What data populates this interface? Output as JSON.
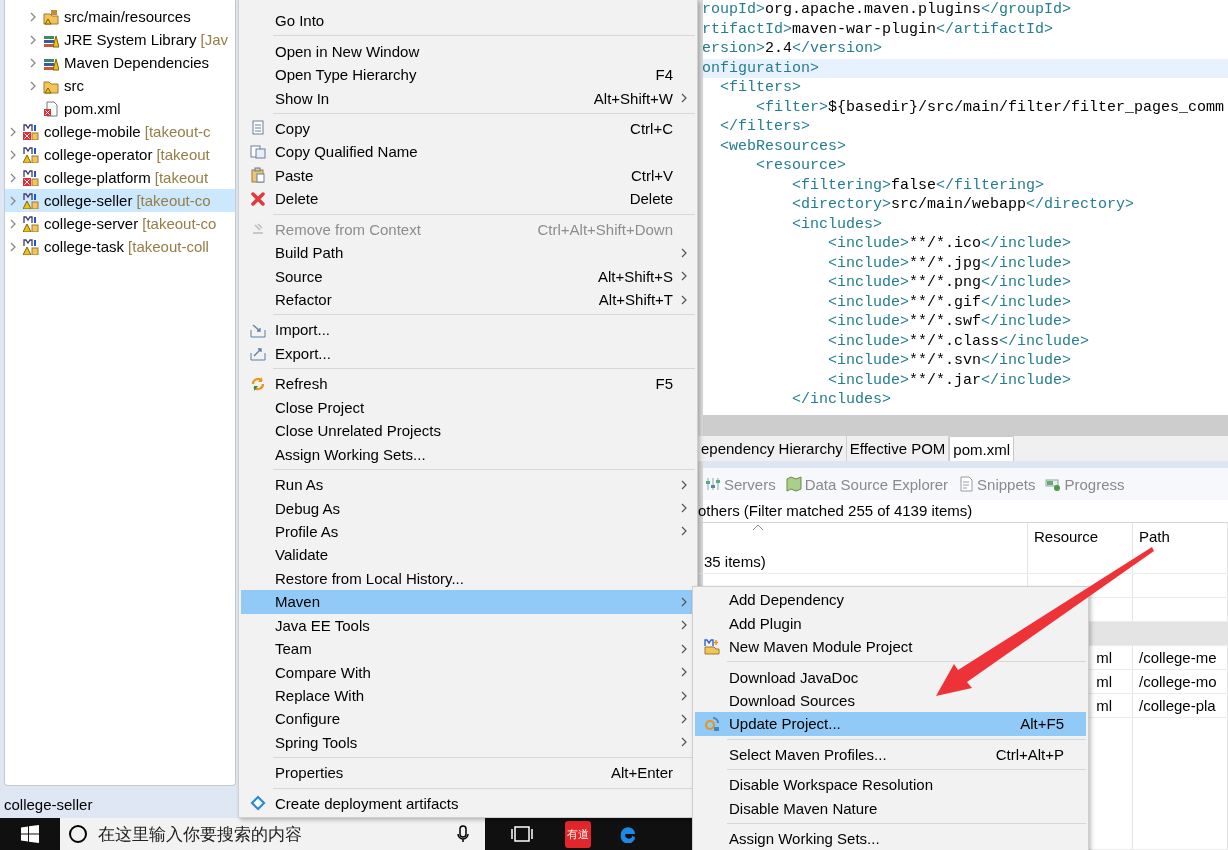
{
  "tree": {
    "items": [
      {
        "children": [
          {
            "label": "src/main/resources",
            "kind": "source",
            "expandable": true,
            "selected": false
          },
          {
            "label": "JRE System Library",
            "decoration": "[Jav",
            "kind": "library",
            "expandable": true,
            "selected": false
          },
          {
            "label": "Maven Dependencies",
            "kind": "library",
            "expandable": true,
            "selected": false
          },
          {
            "label": "src",
            "kind": "folder",
            "expandable": true,
            "selected": false
          },
          {
            "label": "pom.xml",
            "kind": "xml",
            "expandable": false,
            "selected": false
          }
        ]
      },
      {
        "label": "college-mobile",
        "decoration": "[takeout-c",
        "error": true,
        "expandable": true,
        "selected": false
      },
      {
        "label": "college-operator",
        "decoration": "[takeout",
        "error": false,
        "expandable": true,
        "selected": false
      },
      {
        "label": "college-platform",
        "decoration": "[takeout",
        "error": true,
        "expandable": true,
        "selected": false
      },
      {
        "label": "college-seller",
        "decoration": "[takeout-co",
        "error": false,
        "expandable": true,
        "selected": true
      },
      {
        "label": "college-server",
        "decoration": "[takeout-co",
        "error": false,
        "expandable": true,
        "selected": false
      },
      {
        "label": "college-task",
        "decoration": "[takeout-coll",
        "error": false,
        "expandable": true,
        "selected": false
      }
    ]
  },
  "status_bar": {
    "text": "college-seller"
  },
  "taskbar": {
    "search": {
      "placeholder": "在这里输入你要搜索的内容"
    },
    "apps": [
      {
        "kind": "taskview"
      },
      {
        "kind": "youdao",
        "label": "有道"
      },
      {
        "kind": "edge"
      }
    ]
  },
  "editor": {
    "lines": [
      {
        "current": false,
        "segments": [
          {
            "kind": "tag",
            "text": "roupId>"
          },
          {
            "kind": "text",
            "text": "org.apache.maven.plugins"
          },
          {
            "kind": "tag",
            "text": "</groupId>"
          }
        ]
      },
      {
        "current": false,
        "segments": [
          {
            "kind": "tag",
            "text": "rtifactId>"
          },
          {
            "kind": "text",
            "text": "maven-war-plugin"
          },
          {
            "kind": "tag",
            "text": "</artifactId>"
          }
        ]
      },
      {
        "current": false,
        "segments": [
          {
            "kind": "tag",
            "text": "ersion>"
          },
          {
            "kind": "text",
            "text": "2.4"
          },
          {
            "kind": "tag",
            "text": "</version>"
          }
        ]
      },
      {
        "current": true,
        "segments": [
          {
            "kind": "tag",
            "text": "onfiguration>"
          }
        ]
      },
      {
        "current": false,
        "segments": [
          {
            "kind": "tag",
            "text": "  <filters>"
          }
        ]
      },
      {
        "current": false,
        "segments": [
          {
            "kind": "tag",
            "text": "      <filter>"
          },
          {
            "kind": "text",
            "text": "${basedir}/src/main/filter/filter_pages_comm"
          }
        ]
      },
      {
        "current": false,
        "segments": [
          {
            "kind": "tag",
            "text": "  </filters>"
          }
        ]
      },
      {
        "current": false,
        "segments": [
          {
            "kind": "tag",
            "text": "  <webResources>"
          }
        ]
      },
      {
        "current": false,
        "segments": [
          {
            "kind": "tag",
            "text": "      <resource>"
          }
        ]
      },
      {
        "current": false,
        "segments": [
          {
            "kind": "tag",
            "text": "          <filtering>"
          },
          {
            "kind": "text",
            "text": "false"
          },
          {
            "kind": "tag",
            "text": "</filtering>"
          }
        ]
      },
      {
        "current": false,
        "segments": [
          {
            "kind": "tag",
            "text": "          <directory>"
          },
          {
            "kind": "text",
            "text": "src/main/webapp"
          },
          {
            "kind": "tag",
            "text": "</directory>"
          }
        ]
      },
      {
        "current": false,
        "segments": [
          {
            "kind": "tag",
            "text": "          <includes>"
          }
        ]
      },
      {
        "current": false,
        "segments": [
          {
            "kind": "tag",
            "text": "              <include>"
          },
          {
            "kind": "text",
            "text": "**/*.ico"
          },
          {
            "kind": "tag",
            "text": "</include>"
          }
        ]
      },
      {
        "current": false,
        "segments": [
          {
            "kind": "tag",
            "text": "              <include>"
          },
          {
            "kind": "text",
            "text": "**/*.jpg"
          },
          {
            "kind": "tag",
            "text": "</include>"
          }
        ]
      },
      {
        "current": false,
        "segments": [
          {
            "kind": "tag",
            "text": "              <include>"
          },
          {
            "kind": "text",
            "text": "**/*.png"
          },
          {
            "kind": "tag",
            "text": "</include>"
          }
        ]
      },
      {
        "current": false,
        "segments": [
          {
            "kind": "tag",
            "text": "              <include>"
          },
          {
            "kind": "text",
            "text": "**/*.gif"
          },
          {
            "kind": "tag",
            "text": "</include>"
          }
        ]
      },
      {
        "current": false,
        "segments": [
          {
            "kind": "tag",
            "text": "              <include>"
          },
          {
            "kind": "text",
            "text": "**/*.swf"
          },
          {
            "kind": "tag",
            "text": "</include>"
          }
        ]
      },
      {
        "current": false,
        "segments": [
          {
            "kind": "tag",
            "text": "              <include>"
          },
          {
            "kind": "text",
            "text": "**/*.class"
          },
          {
            "kind": "tag",
            "text": "</include>"
          }
        ]
      },
      {
        "current": false,
        "segments": [
          {
            "kind": "tag",
            "text": "              <include>"
          },
          {
            "kind": "text",
            "text": "**/*.svn"
          },
          {
            "kind": "tag",
            "text": "</include>"
          }
        ]
      },
      {
        "current": false,
        "segments": [
          {
            "kind": "tag",
            "text": "              <include>"
          },
          {
            "kind": "text",
            "text": "**/*.jar"
          },
          {
            "kind": "tag",
            "text": "</include>"
          }
        ]
      },
      {
        "current": false,
        "segments": [
          {
            "kind": "tag",
            "text": "          </includes>"
          }
        ]
      }
    ]
  },
  "editor_tabs": [
    {
      "label": "ependency Hierarchy",
      "selected": false
    },
    {
      "label": "Effective POM",
      "selected": false
    },
    {
      "label": "pom.xml",
      "selected": true
    }
  ],
  "views": [
    {
      "label": "Servers",
      "kind": "servers"
    },
    {
      "label": "Data Source Explorer",
      "kind": "datasource"
    },
    {
      "label": "Snippets",
      "kind": "snippets"
    },
    {
      "label": "Progress",
      "kind": "progress"
    }
  ],
  "problems": {
    "summary": "others (Filter matched 255 of 4139 items)",
    "columns": [
      {
        "sorted": true
      },
      {
        "label": "Resource",
        "sorted": false
      },
      {
        "label": "Path",
        "sorted": false
      }
    ],
    "rows": [
      {
        "kind": "category",
        "name": "35 items)"
      },
      {
        "kind": "blank"
      },
      {
        "kind": "blank"
      },
      {
        "kind": "shaded"
      },
      {
        "kind": "file",
        "resource": "ml",
        "path": "/college-me"
      },
      {
        "kind": "file",
        "resource": "ml",
        "path": "/college-mo"
      },
      {
        "kind": "file",
        "resource": "ml",
        "path": "/college-pla"
      }
    ]
  },
  "context_menu": {
    "groups": [
      [
        {
          "label": "Go Into",
          "kind": "plain",
          "submenu": false,
          "selected": false,
          "disabled": false
        }
      ],
      [
        {
          "label": "Open in New Window",
          "kind": "plain",
          "submenu": false,
          "selected": false,
          "disabled": false
        },
        {
          "label": "Open Type Hierarchy",
          "shortcut": "F4",
          "kind": "plain",
          "submenu": false,
          "selected": false,
          "disabled": false
        },
        {
          "label": "Show In",
          "shortcut": "Alt+Shift+W",
          "kind": "plain",
          "submenu": true,
          "selected": false,
          "disabled": false
        }
      ],
      [
        {
          "label": "Copy",
          "shortcut": "Ctrl+C",
          "kind": "copy",
          "submenu": false,
          "selected": false,
          "disabled": false
        },
        {
          "label": "Copy Qualified Name",
          "kind": "copyname",
          "submenu": false,
          "selected": false,
          "disabled": false
        },
        {
          "label": "Paste",
          "shortcut": "Ctrl+V",
          "kind": "paste",
          "submenu": false,
          "selected": false,
          "disabled": false
        },
        {
          "label": "Delete",
          "shortcut": "Delete",
          "kind": "delete",
          "submenu": false,
          "selected": false,
          "disabled": false
        }
      ],
      [
        {
          "label": "Remove from Context",
          "shortcut": "Ctrl+Alt+Shift+Down",
          "kind": "remove",
          "submenu": false,
          "selected": false,
          "disabled": true
        },
        {
          "label": "Build Path",
          "kind": "plain",
          "submenu": true,
          "selected": false,
          "disabled": false
        },
        {
          "label": "Source",
          "shortcut": "Alt+Shift+S",
          "kind": "plain",
          "submenu": true,
          "selected": false,
          "disabled": false
        },
        {
          "label": "Refactor",
          "shortcut": "Alt+Shift+T",
          "kind": "plain",
          "submenu": true,
          "selected": false,
          "disabled": false
        }
      ],
      [
        {
          "label": "Import...",
          "kind": "import",
          "submenu": false,
          "selected": false,
          "disabled": false
        },
        {
          "label": "Export...",
          "kind": "export",
          "submenu": false,
          "selected": false,
          "disabled": false
        }
      ],
      [
        {
          "label": "Refresh",
          "shortcut": "F5",
          "kind": "refresh",
          "submenu": false,
          "selected": false,
          "disabled": false
        },
        {
          "label": "Close Project",
          "kind": "plain",
          "submenu": false,
          "selected": false,
          "disabled": false
        },
        {
          "label": "Close Unrelated Projects",
          "kind": "plain",
          "submenu": false,
          "selected": false,
          "disabled": false
        },
        {
          "label": "Assign Working Sets...",
          "kind": "plain",
          "submenu": false,
          "selected": false,
          "disabled": false
        }
      ],
      [
        {
          "label": "Run As",
          "kind": "plain",
          "submenu": true,
          "selected": false,
          "disabled": false
        },
        {
          "label": "Debug As",
          "kind": "plain",
          "submenu": true,
          "selected": false,
          "disabled": false
        },
        {
          "label": "Profile As",
          "kind": "plain",
          "submenu": true,
          "selected": false,
          "disabled": false
        },
        {
          "label": "Validate",
          "kind": "plain",
          "submenu": false,
          "selected": false,
          "disabled": false
        },
        {
          "label": "Restore from Local History...",
          "kind": "plain",
          "submenu": false,
          "selected": false,
          "disabled": false
        },
        {
          "label": "Maven",
          "kind": "plain",
          "submenu": true,
          "selected": true,
          "disabled": false
        },
        {
          "label": "Java EE Tools",
          "kind": "plain",
          "submenu": true,
          "selected": false,
          "disabled": false
        },
        {
          "label": "Team",
          "kind": "plain",
          "submenu": true,
          "selected": false,
          "disabled": false
        },
        {
          "label": "Compare With",
          "kind": "plain",
          "submenu": true,
          "selected": false,
          "disabled": false
        },
        {
          "label": "Replace With",
          "kind": "plain",
          "submenu": true,
          "selected": false,
          "disabled": false
        },
        {
          "label": "Configure",
          "kind": "plain",
          "submenu": true,
          "selected": false,
          "disabled": false
        },
        {
          "label": "Spring Tools",
          "kind": "plain",
          "submenu": true,
          "selected": false,
          "disabled": false
        }
      ],
      [
        {
          "label": "Properties",
          "shortcut": "Alt+Enter",
          "kind": "plain",
          "submenu": false,
          "selected": false,
          "disabled": false
        }
      ],
      [
        {
          "label": "Create deployment artifacts",
          "kind": "deploy",
          "submenu": false,
          "selected": false,
          "disabled": false
        }
      ]
    ]
  },
  "maven_submenu": {
    "groups": [
      [
        {
          "label": "Add Dependency",
          "kind": "plain",
          "submenu": false,
          "selected": false,
          "disabled": false
        },
        {
          "label": "Add Plugin",
          "kind": "plain",
          "submenu": false,
          "selected": false,
          "disabled": false
        },
        {
          "label": "New Maven Module Project",
          "kind": "module",
          "submenu": false,
          "selected": false,
          "disabled": false
        }
      ],
      [
        {
          "label": "Download JavaDoc",
          "kind": "plain",
          "submenu": false,
          "selected": false,
          "disabled": false
        },
        {
          "label": "Download Sources",
          "kind": "plain",
          "submenu": false,
          "selected": false,
          "disabled": false
        },
        {
          "label": "Update Project...",
          "shortcut": "Alt+F5",
          "kind": "update",
          "submenu": false,
          "selected": true,
          "disabled": false
        }
      ],
      [
        {
          "label": "Select Maven Profiles...",
          "shortcut": "Ctrl+Alt+P",
          "kind": "plain",
          "submenu": false,
          "selected": false,
          "disabled": false
        }
      ],
      [
        {
          "label": "Disable Workspace Resolution",
          "kind": "plain",
          "submenu": false,
          "selected": false,
          "disabled": false
        },
        {
          "label": "Disable Maven Nature",
          "kind": "plain",
          "submenu": false,
          "selected": false,
          "disabled": false
        }
      ],
      [
        {
          "label": "Assign Working Sets...",
          "kind": "plain",
          "submenu": false,
          "selected": false,
          "disabled": false
        }
      ]
    ]
  }
}
